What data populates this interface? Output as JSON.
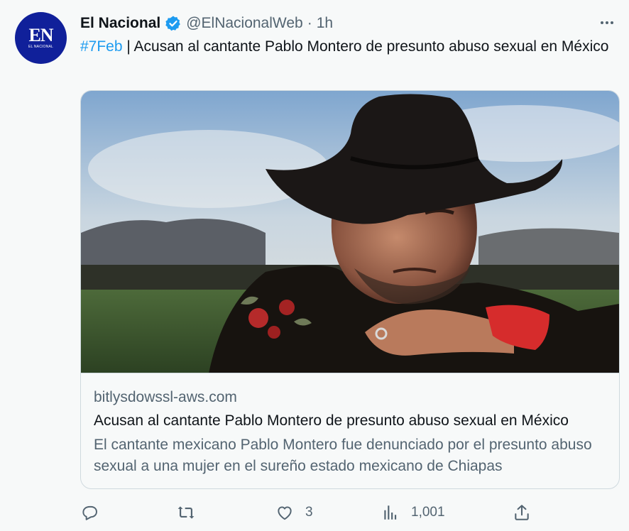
{
  "author": {
    "name": "El Nacional",
    "handle": "@ElNacionalWeb",
    "separator": "·",
    "time": "1h",
    "avatar_text": "EN",
    "avatar_subtext": "EL NACIONAL",
    "verified": true
  },
  "tweet": {
    "hashtag": "#7Feb",
    "text": " | Acusan al cantante Pablo Montero de presunto abuso sexual en México"
  },
  "card": {
    "domain": "bitlysdowssl-aws.com",
    "title": "Acusan al cantante Pablo Montero de presunto abuso sexual en México",
    "description": "El cantante mexicano Pablo Montero fue denunciado por el presunto abuso sexual a una mujer en el sureño estado mexicano de Chiapas"
  },
  "actions": {
    "reply": {
      "icon": "reply-icon",
      "count": ""
    },
    "retweet": {
      "icon": "retweet-icon",
      "count": ""
    },
    "like": {
      "icon": "heart-icon",
      "count": "3"
    },
    "views": {
      "icon": "views-icon",
      "count": "1,001"
    },
    "share": {
      "icon": "share-icon",
      "count": ""
    }
  },
  "colors": {
    "accent": "#1d9bf0",
    "text": "#0f1419",
    "secondary": "#536471",
    "background": "#f7f9f9",
    "avatar": "#10209a"
  }
}
